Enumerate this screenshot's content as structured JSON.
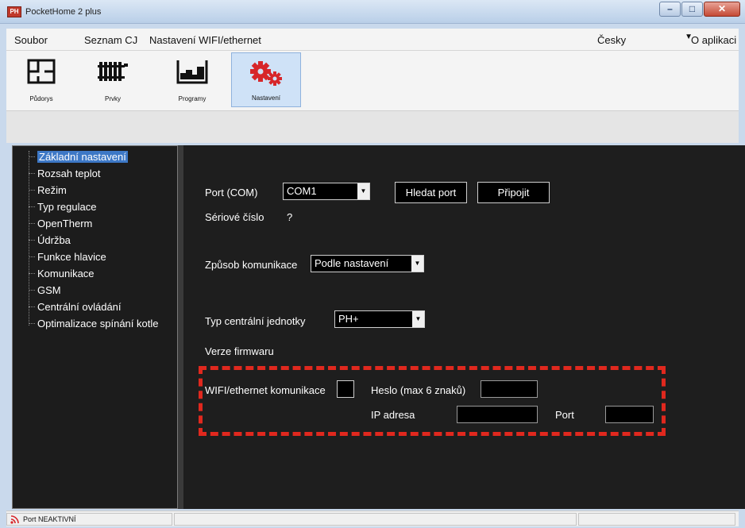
{
  "window": {
    "title": "PocketHome 2 plus",
    "icon_text": "PH"
  },
  "menu": {
    "items": [
      "Soubor",
      "Seznam CJ",
      "Nastavení WIFI/ethernet"
    ],
    "language": "Česky",
    "about": "O aplikaci"
  },
  "toolbar": {
    "tools": [
      {
        "label": "Půdorys",
        "icon": "floorplan-icon"
      },
      {
        "label": "Prvky",
        "icon": "radiator-icon"
      },
      {
        "label": "Programy",
        "icon": "program-chart-icon"
      },
      {
        "label": "Nastavení",
        "icon": "gears-icon",
        "active": true
      }
    ]
  },
  "tree": {
    "items": [
      "Základní nastavení",
      "Rozsah teplot",
      "Režim",
      "Typ regulace",
      "OpenTherm",
      "Údržba",
      "Funkce hlavice",
      "Komunikace",
      "GSM",
      "Centrální ovládání",
      "Optimalizace spínání kotle"
    ],
    "selected": "Základní nastavení"
  },
  "settings": {
    "port_label": "Port (COM)",
    "port_value": "COM1",
    "find_port_button": "Hledat port",
    "connect_button": "Připojit",
    "serial_label": "Sériové číslo",
    "serial_value": "?",
    "comm_label": "Způsob komunikace",
    "comm_value": "Podle nastavení",
    "unit_label": "Typ centrální jednotky",
    "unit_value": "PH+",
    "firmware_label": "Verze firmwaru",
    "wifi_label": "WIFI/ethernet komunikace",
    "password_label": "Heslo (max 6 znaků)",
    "ip_label": "IP adresa",
    "port2_label": "Port"
  },
  "status": {
    "text": "Port NEAKTIVNÍ"
  },
  "colors": {
    "accent_red": "#e0281e",
    "selection_blue": "#3d78c6",
    "panel_dark": "#1e1e1e"
  }
}
